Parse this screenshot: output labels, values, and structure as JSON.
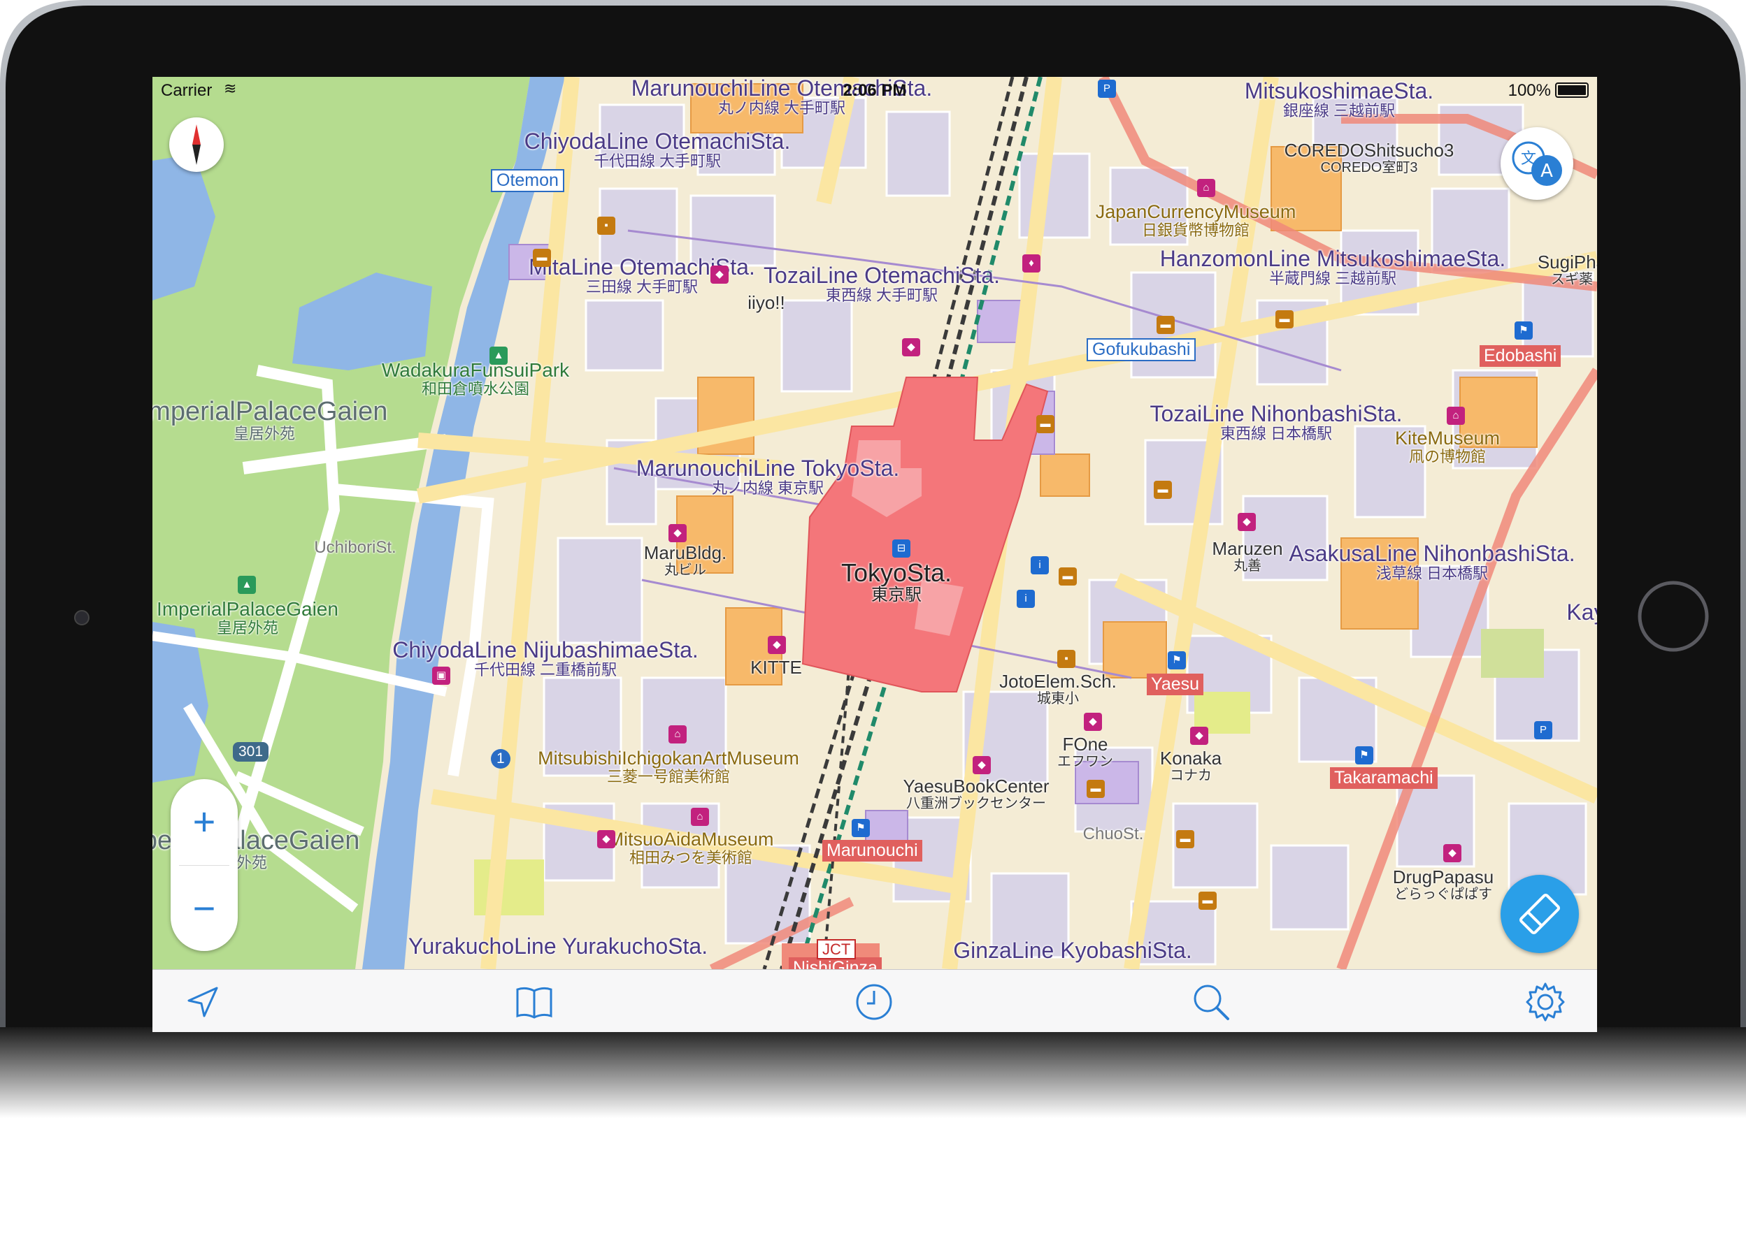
{
  "status_bar": {
    "carrier": "Carrier",
    "time": "2:06 PM",
    "battery": "100%"
  },
  "map": {
    "station_labels": [
      {
        "en": "MarunouchiLine OtemachiSta.",
        "jp": "丸ノ内線 大手町駅"
      },
      {
        "en": "ChiyodaLine OtemachiSta.",
        "jp": "千代田線 大手町駅"
      },
      {
        "en": "MitaLine OtemachiSta.",
        "jp": "三田線 大手町駅"
      },
      {
        "en": "TozaiLine OtemachiSta.",
        "jp": "東西線 大手町駅"
      },
      {
        "en": "MitsukoshimaeSta.",
        "jp": "銀座線 三越前駅"
      },
      {
        "en": "HanzomonLine MitsukoshimaeSta.",
        "jp": "半蔵門線 三越前駅"
      },
      {
        "en": "TozaiLine NihonbashiSta.",
        "jp": "東西線 日本橋駅"
      },
      {
        "en": "MarunouchiLine TokyoSta.",
        "jp": "丸ノ内線 東京駅"
      },
      {
        "en": "AsakusaLine NihonbashiSta.",
        "jp": "浅草線 日本橋駅"
      },
      {
        "en": "ChiyodaLine NijubashimaeSta.",
        "jp": "千代田線 二重橋前駅"
      },
      {
        "en": "YurakuchoLine YurakuchoSta.",
        "jp": ""
      },
      {
        "en": "GinzaLine KyobashiSta.",
        "jp": ""
      }
    ],
    "tokyo_station": {
      "en": "TokyoSta.",
      "jp": "東京駅"
    },
    "parks": [
      {
        "en": "WadakuraFunsuiPark",
        "jp": "和田倉噴水公園"
      },
      {
        "en": "ImperialPalaceGaien",
        "jp": "皇居外苑"
      }
    ],
    "gaien_labels": [
      {
        "en": "ImperialPalaceGaien",
        "jp": "皇居外苑"
      },
      {
        "en": "ImperialPalaceGaien",
        "jp": "皇居外苑"
      }
    ],
    "museums": [
      {
        "en": "JapanCurrencyMuseum",
        "jp": "日銀貨幣博物館"
      },
      {
        "en": "KiteMuseum",
        "jp": "凧の博物館"
      },
      {
        "en": "MitsubishiIchigokanArtMuseum",
        "jp": "三菱一号館美術館"
      },
      {
        "en": "MitsuoAidaMuseum",
        "jp": "相田みつを美術館"
      }
    ],
    "pois": [
      {
        "en": "COREDOShitsucho3",
        "jp": "COREDO室町3"
      },
      {
        "en": "iiyo!!",
        "jp": ""
      },
      {
        "en": "MaruBldg.",
        "jp": "丸ビル"
      },
      {
        "en": "KITTE",
        "jp": ""
      },
      {
        "en": "Maruzen",
        "jp": "丸善"
      },
      {
        "en": "JotoElem.Sch.",
        "jp": "城東小"
      },
      {
        "en": "FOne",
        "jp": "エフワン"
      },
      {
        "en": "Konaka",
        "jp": "コナカ"
      },
      {
        "en": "YaesuBookCenter",
        "jp": "八重洲ブックセンター"
      },
      {
        "en": "DrugPapasu",
        "jp": "どらっぐぱぱす"
      },
      {
        "en": "SugiPha",
        "jp": "スギ薬"
      }
    ],
    "streets": [
      "UchiboriSt.",
      "ChuoSt."
    ],
    "tags_red": [
      "Edobashi",
      "Yaesu",
      "Takaramachi",
      "Marunouchi",
      "NishiGinza"
    ],
    "tags_blue": [
      "Otemon",
      "Gofukubashi"
    ],
    "shields": [
      "301",
      "1"
    ],
    "jct": "JCT",
    "edge_label": "Kay"
  },
  "controls": {
    "compass": "compass-icon",
    "translate": "translate-icon",
    "zoom_in": "+",
    "zoom_out": "−",
    "eraser": "eraser-icon"
  },
  "tab_bar": [
    "location-arrow-icon",
    "bookmarks-book-icon",
    "history-clock-icon",
    "search-icon",
    "settings-gear-icon"
  ],
  "colors": {
    "accent": "#2a7fd4",
    "station_fill": "#f4767a",
    "park": "#b5dc8f",
    "water": "#8fb6e6",
    "bezel": "#111111"
  }
}
